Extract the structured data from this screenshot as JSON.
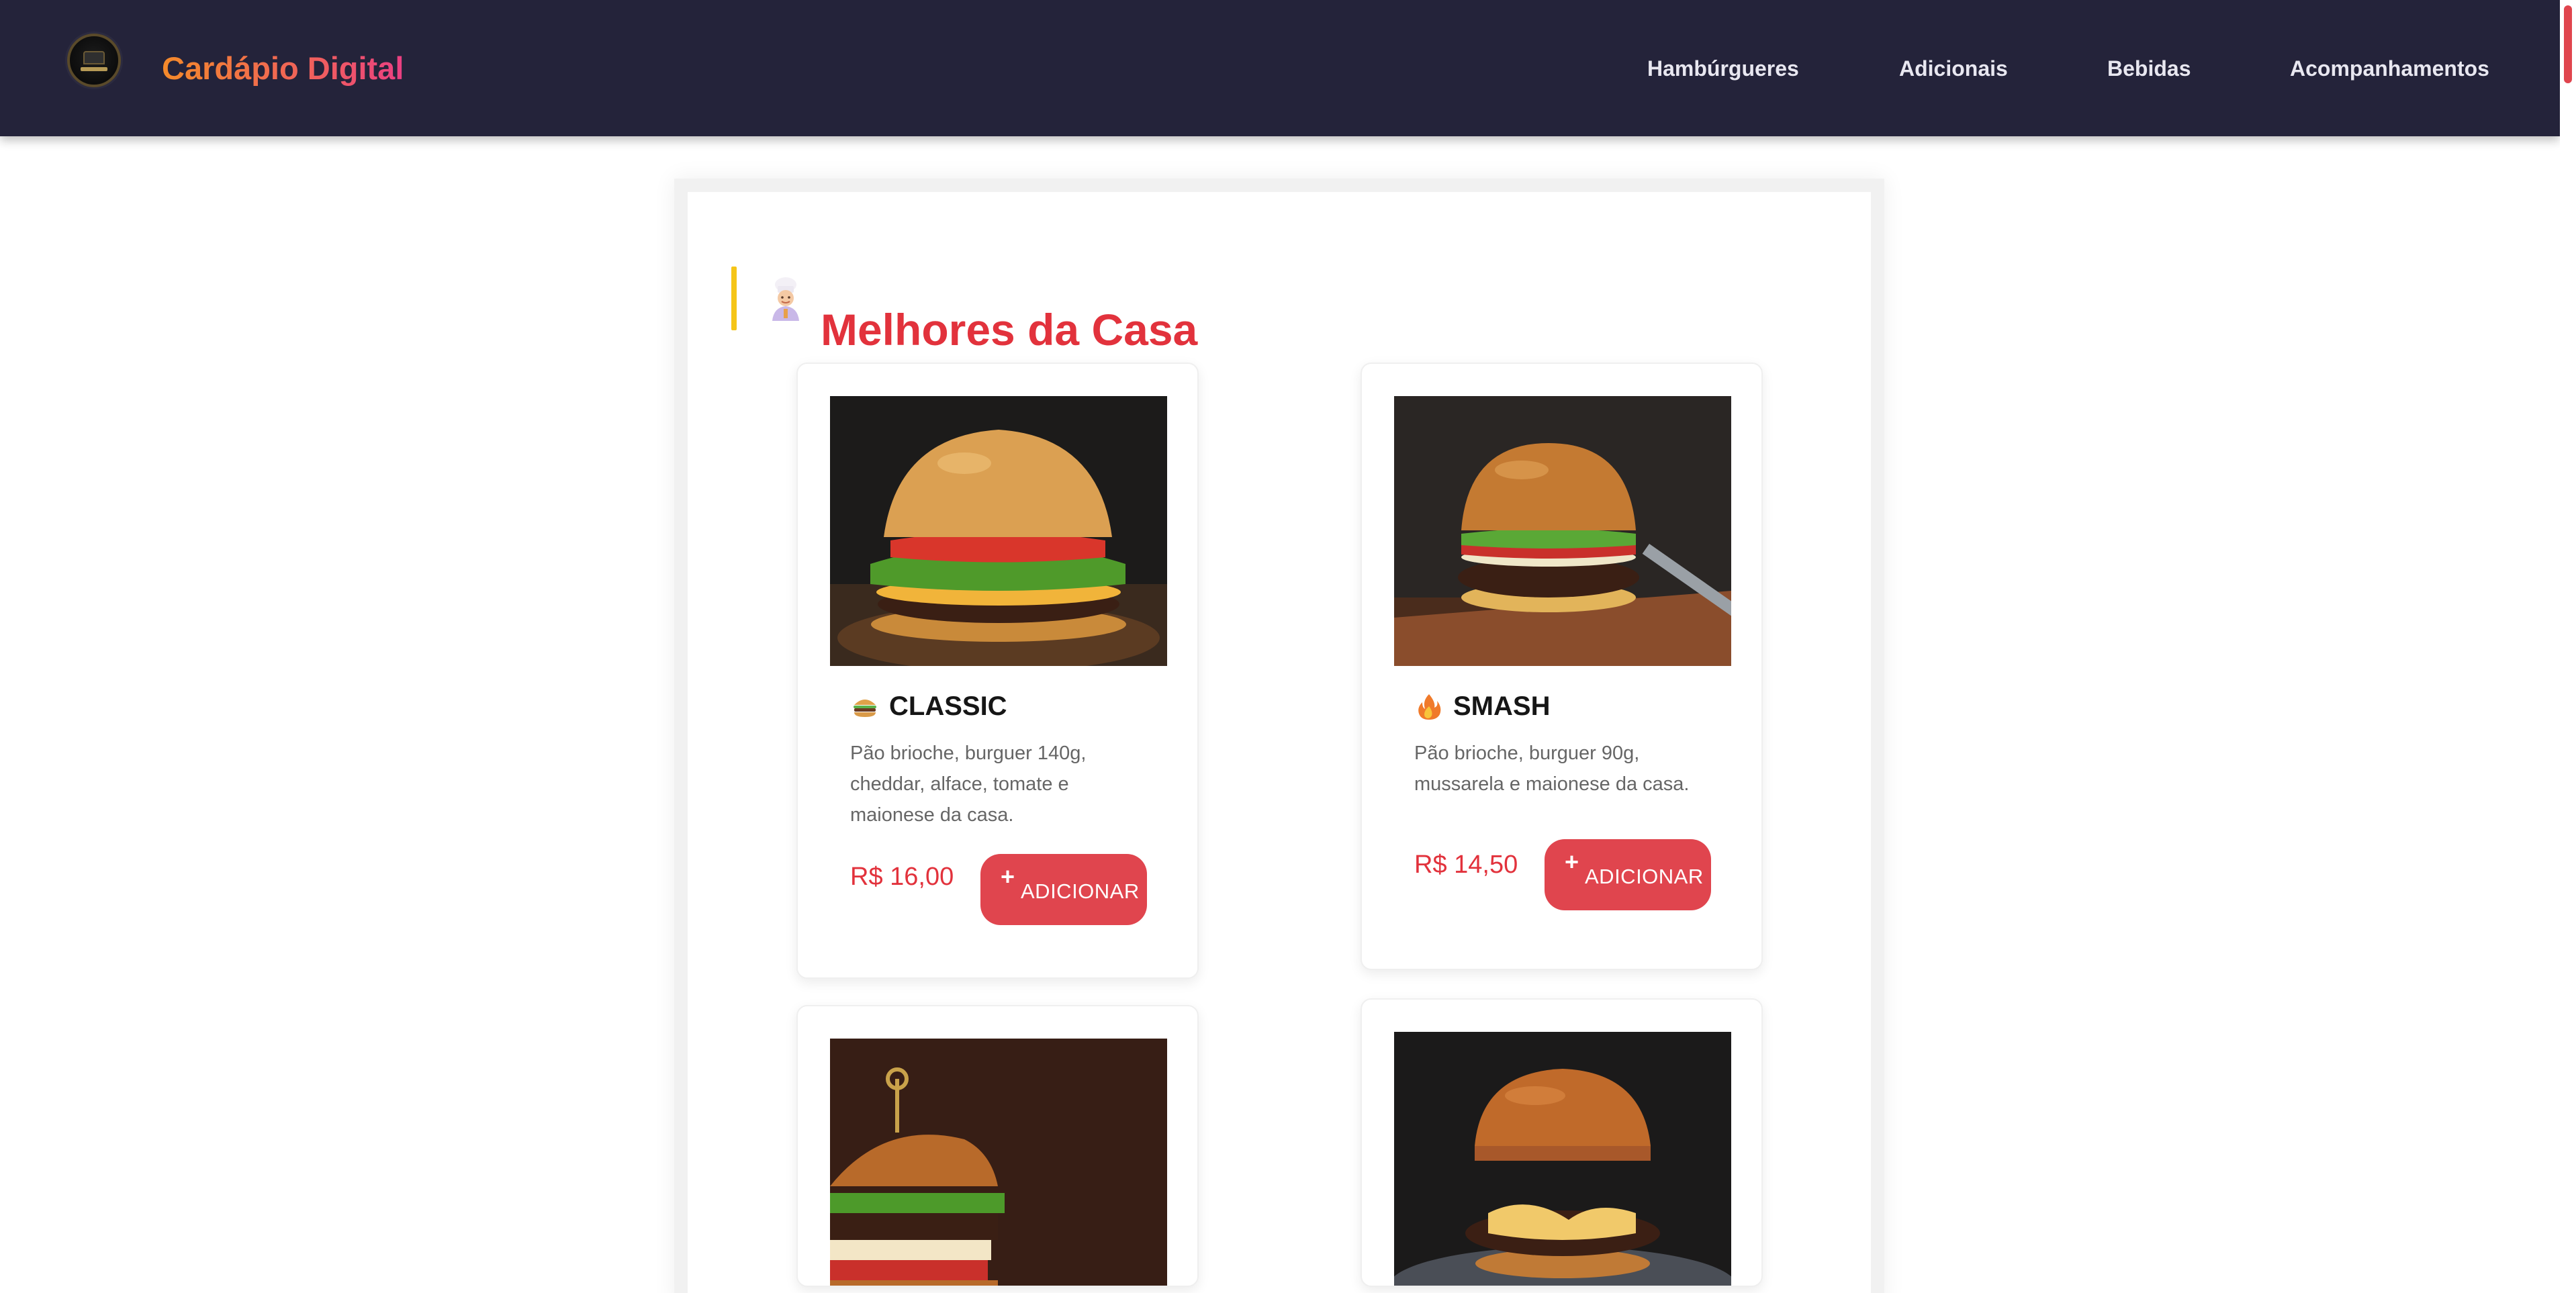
{
  "header": {
    "brand": "Cardápio Digital",
    "logo_icon": "burger-shop-logo",
    "nav": [
      {
        "label": "Hambúrgueres"
      },
      {
        "label": "Adicionais"
      },
      {
        "label": "Bebidas"
      },
      {
        "label": "Acompanhamentos"
      }
    ]
  },
  "section": {
    "title": "Melhores da Casa",
    "icon": "chef-icon"
  },
  "products": [
    {
      "name": "CLASSIC",
      "icon": "burger-icon",
      "description": "Pão brioche, burguer 140g, cheddar, alface, tomate e maionese da casa.",
      "price": "R$ 16,00",
      "button_plus": "+",
      "button_label": "ADICIONAR"
    },
    {
      "name": "SMASH",
      "icon": "fire-icon",
      "description": "Pão brioche, burguer 90g, mussarela e maionese da casa.",
      "price": "R$ 14,50",
      "button_plus": "+",
      "button_label": "ADICIONAR"
    },
    {
      "name": "",
      "icon": "burger-photo"
    },
    {
      "name": "",
      "icon": "burger-photo"
    }
  ],
  "colors": {
    "nav_bg": "#24233a",
    "accent_red": "#e2323c",
    "button_red": "#e0454e",
    "section_bar_yellow": "#f5c518",
    "brand_gradient_start": "#f48a2a",
    "brand_gradient_end": "#ea3f82"
  }
}
